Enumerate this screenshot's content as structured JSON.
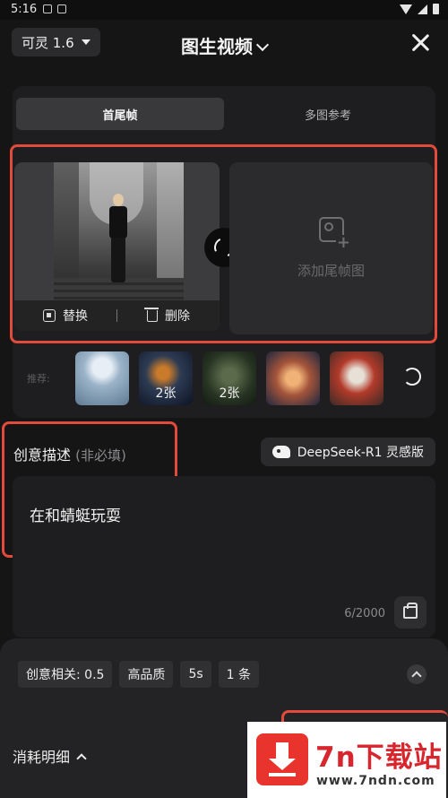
{
  "status": {
    "time": "5:16"
  },
  "header": {
    "model": "可灵 1.6",
    "title": "图生视频"
  },
  "tabs": [
    {
      "label": "首尾帧"
    },
    {
      "label": "多图参考"
    }
  ],
  "first_frame": {
    "replace": "替换",
    "delete": "删除"
  },
  "last_frame": {
    "label": "添加尾帧图"
  },
  "recommend": {
    "label": "推荐:",
    "items": [
      {
        "count": ""
      },
      {
        "count": "2张"
      },
      {
        "count": "2张"
      },
      {
        "count": ""
      },
      {
        "count": ""
      }
    ]
  },
  "description": {
    "title": "创意描述",
    "optional": "(非必填)",
    "deepseek": "DeepSeek-R1 灵感版",
    "text": "在和蜻蜓玩耍",
    "counter": "6/2000"
  },
  "params": {
    "creativity": "创意相关: 0.5",
    "quality": "高品质",
    "duration": "5s",
    "count": "1 条"
  },
  "cost": {
    "label": "消耗明细"
  },
  "watermark": {
    "title": "7n下载站",
    "url": "www.7ndn.com"
  },
  "colors": {
    "highlight": "#e24a3b",
    "background": "#151516",
    "card": "#1e1e20"
  }
}
